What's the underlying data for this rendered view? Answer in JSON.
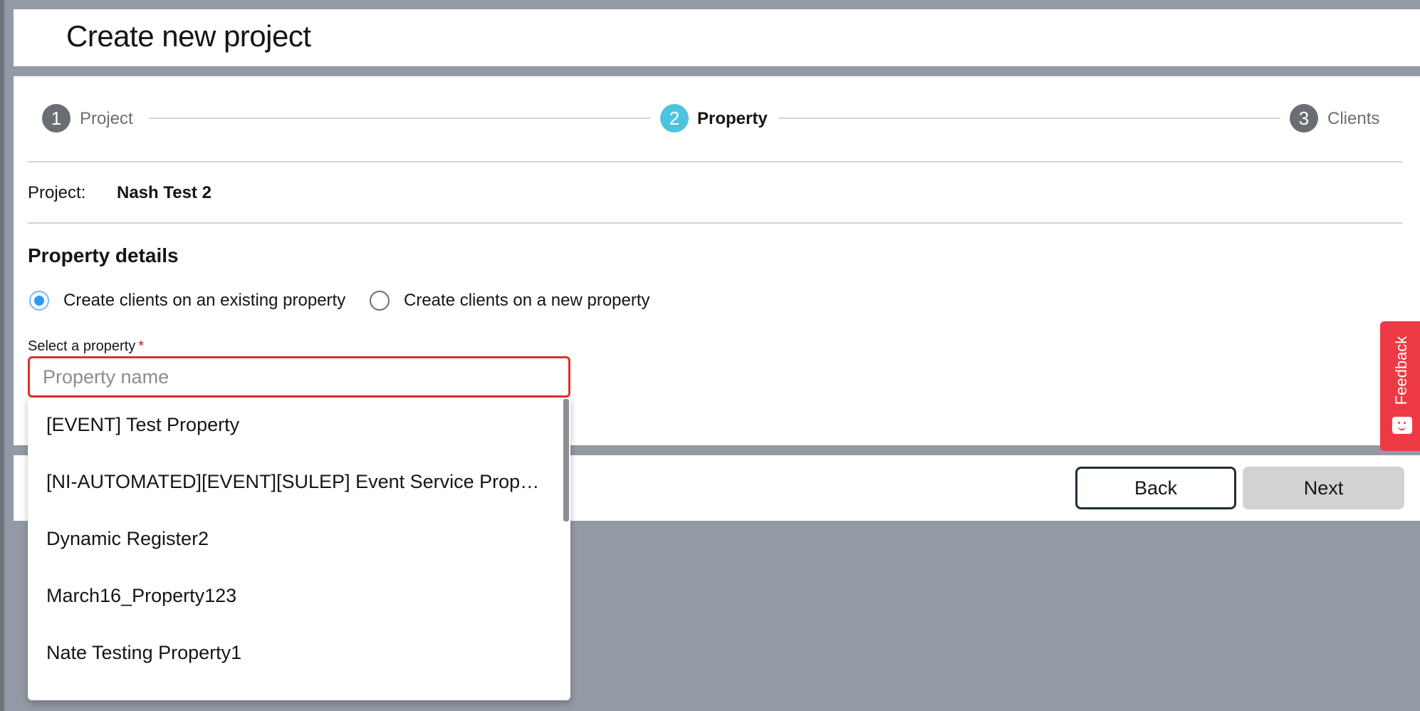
{
  "header": {
    "title": "Create new project"
  },
  "stepper": {
    "steps": [
      {
        "number": "1",
        "label": "Project",
        "state": "complete"
      },
      {
        "number": "2",
        "label": "Property",
        "state": "current"
      },
      {
        "number": "3",
        "label": "Clients",
        "state": "upcoming"
      }
    ]
  },
  "project": {
    "label": "Project:",
    "value": "Nash Test 2"
  },
  "property_details": {
    "title": "Property details",
    "options": [
      {
        "label": "Create clients on an existing property",
        "selected": true
      },
      {
        "label": "Create clients on a new property",
        "selected": false
      }
    ],
    "select_label": "Select a property",
    "required_marker": "*",
    "input_value": "",
    "input_placeholder": "Property name",
    "dropdown_items": [
      "[EVENT] Test Property",
      "[NI-AUTOMATED][EVENT][SULEP] Event Service Proper…",
      "Dynamic Register2",
      "March16_Property123",
      "Nate Testing Property1"
    ]
  },
  "footer": {
    "back_label": "Back",
    "next_label": "Next"
  },
  "feedback": {
    "label": "Feedback",
    "icon": "chat-smile-icon"
  },
  "colors": {
    "accent": "#4ec3e0",
    "error_border": "#e0312a",
    "feedback_bg": "#ee3a44",
    "step_inactive": "#6a6e73"
  }
}
